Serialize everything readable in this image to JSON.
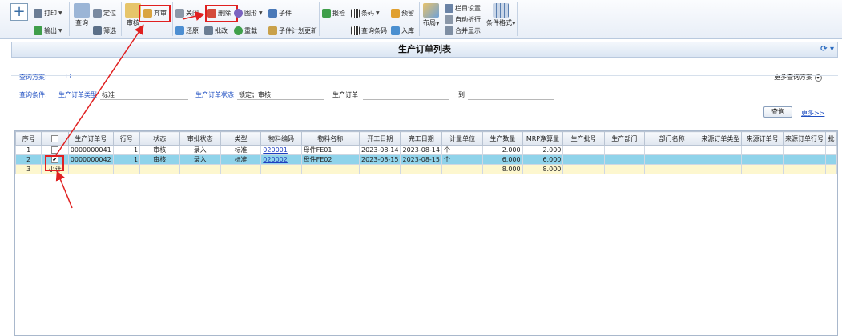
{
  "toolbar": {
    "print": "打印",
    "export": "输出",
    "query": "查询",
    "locate": "定位",
    "filter": "筛选",
    "audit": "审核",
    "unaudit": "弃审",
    "close": "关闭",
    "restore": "还原",
    "delete": "删除",
    "batch_edit": "批改",
    "graph": "图形",
    "reload": "重载",
    "child": "子件",
    "child_plan_update": "子件计划更新",
    "report_check": "报检",
    "barcode": "条码",
    "query_barcode": "查询条码",
    "reserve": "预留",
    "warehouse_in": "入库",
    "layout": "布局",
    "column_settings": "栏目设置",
    "auto_wrap": "自动折行",
    "merge_display": "合并显示",
    "conditional_format": "条件格式"
  },
  "page": {
    "title": "生产订单列表"
  },
  "query": {
    "scheme_label": "查询方案:",
    "scheme_value": "11",
    "more_schemes": "更多查询方案",
    "conditions_label": "查询条件:",
    "order_type_label": "生产订单类型",
    "order_type_value": "标准",
    "order_status_label": "生产订单状态",
    "order_status_value": "锁定；审核",
    "order_no_label": "生产订单",
    "to_label": "到",
    "query_button": "查询",
    "more_link": "更多>>"
  },
  "grid": {
    "columns": [
      "序号",
      "",
      "生产订单号",
      "行号",
      "状态",
      "审批状态",
      "类型",
      "物料编码",
      "物料名称",
      "开工日期",
      "完工日期",
      "计量单位",
      "生产数量",
      "MRP净算量",
      "生产批号",
      "生产部门",
      "部门名称",
      "来源订单类型",
      "来源订单号",
      "来源订单行号",
      "批"
    ],
    "rows": [
      {
        "seq": "1",
        "checked": false,
        "order_no": "0000000041",
        "line": "1",
        "status": "审核",
        "approval": "录入",
        "type": "标准",
        "code": "020001",
        "name": "母件FE01",
        "start": "2023-08-14",
        "end": "2023-08-14",
        "unit": "个",
        "qty": "2.000",
        "mrp": "2.000"
      },
      {
        "seq": "2",
        "checked": true,
        "order_no": "0000000042",
        "line": "1",
        "status": "审核",
        "approval": "录入",
        "type": "标准",
        "code": "020002",
        "name": "母件FE02",
        "start": "2023-08-15",
        "end": "2023-08-15",
        "unit": "个",
        "qty": "6.000",
        "mrp": "6.000"
      }
    ],
    "subtotal": {
      "seq": "3",
      "label": "小计",
      "qty": "8.000",
      "mrp": "8.000"
    }
  },
  "colors": {
    "selected_row": "#8fd3ea",
    "subtotal_row": "#fdf7cf",
    "annotation": "#e02020"
  }
}
